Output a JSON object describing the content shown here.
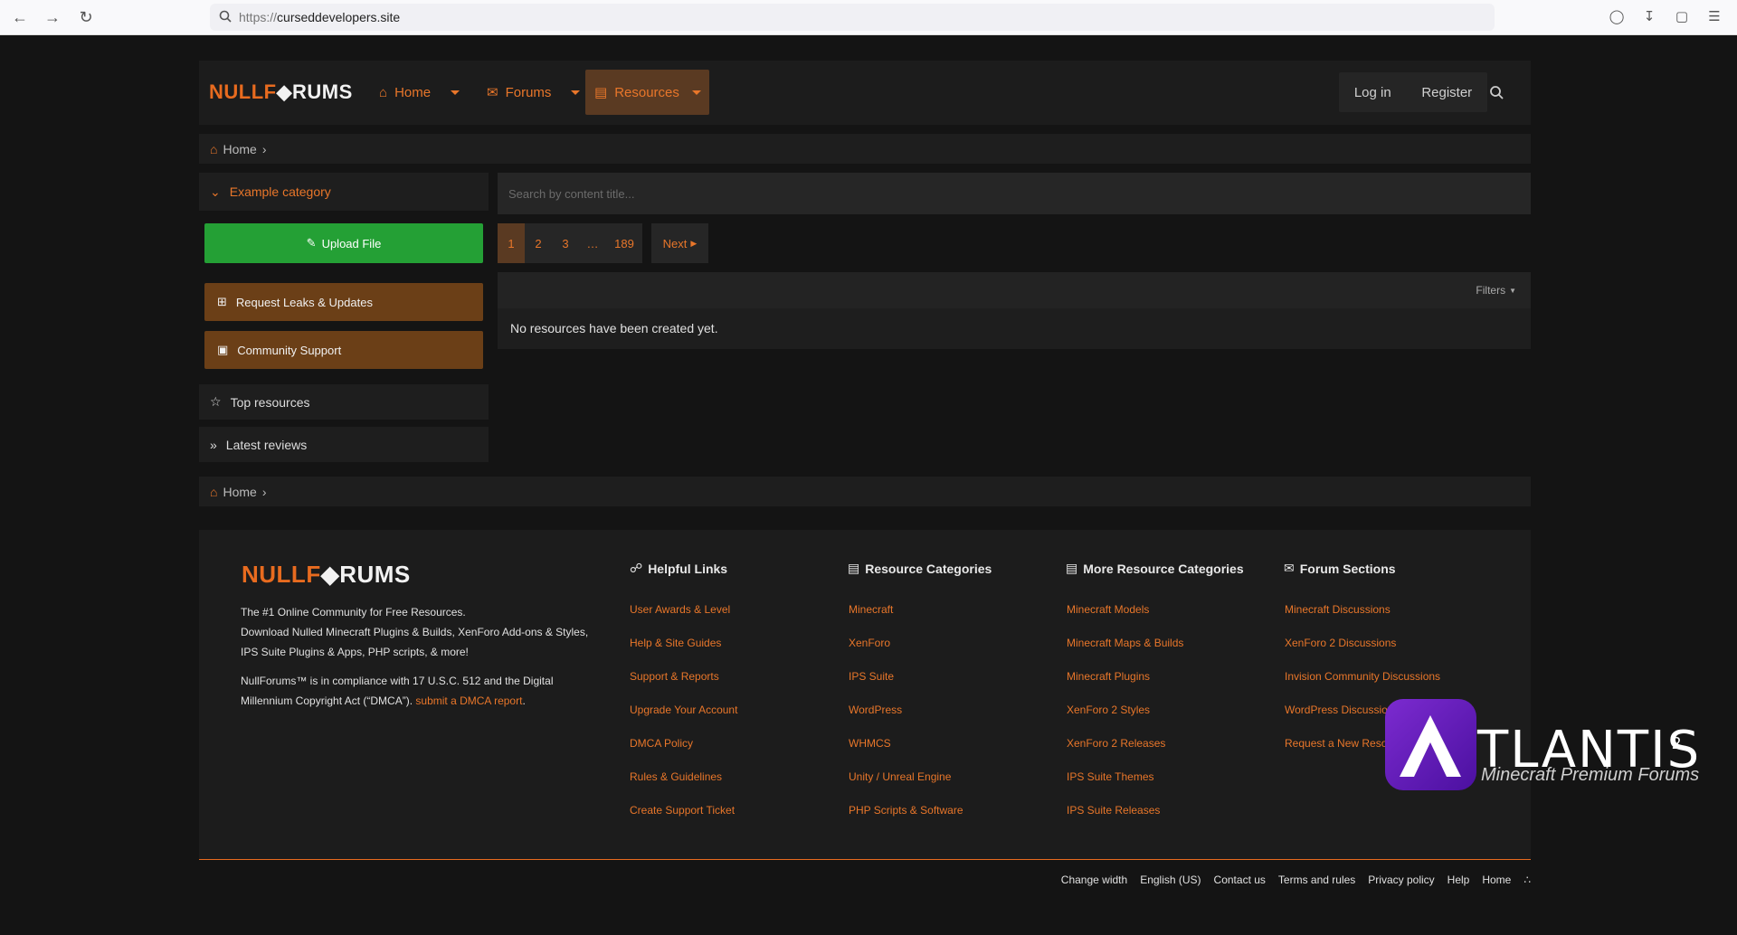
{
  "browser": {
    "url_scheme": "https://",
    "url_host": "curseddevelopers.site"
  },
  "header": {
    "logo_null": "NULLF",
    "logo_rest": "RUMS",
    "nav": {
      "home": "Home",
      "forums": "Forums",
      "resources": "Resources"
    },
    "login": "Log in",
    "register": "Register"
  },
  "breadcrumb": {
    "home": "Home",
    "separator": "›"
  },
  "sidebar": {
    "category": "Example category",
    "upload": "Upload File",
    "request": "Request Leaks & Updates",
    "support": "Community Support",
    "top_resources": "Top resources",
    "latest_reviews": "Latest reviews"
  },
  "main": {
    "search_placeholder": "Search by content title...",
    "pages": [
      "1",
      "2",
      "3",
      "…",
      "189"
    ],
    "next": "Next",
    "filters": "Filters",
    "empty": "No resources have been created yet."
  },
  "footer": {
    "desc1": "The #1 Online Community for Free Resources.",
    "desc2": "Download Nulled Minecraft Plugins & Builds, XenForo Add-ons & Styles,",
    "desc3": "IPS Suite Plugins & Apps, PHP scripts, & more!",
    "legal1": "NullForums™ is in compliance with 17 U.S.C. 512 and the Digital",
    "legal2": "Millennium Copyright Act (“DMCA”).",
    "dmca_link": "submit a DMCA report",
    "columns": {
      "helpful": {
        "title": "Helpful Links",
        "links": [
          "User Awards & Level",
          "Help & Site Guides",
          "Support & Reports",
          "Upgrade Your Account",
          "DMCA Policy",
          "Rules & Guidelines",
          "Create Support Ticket"
        ]
      },
      "categories": {
        "title": "Resource Categories",
        "links": [
          "Minecraft",
          "XenForo",
          "IPS Suite",
          "WordPress",
          "WHMCS",
          "Unity / Unreal Engine",
          "PHP Scripts & Software"
        ]
      },
      "more": {
        "title": "More Resource Categories",
        "links": [
          "Minecraft Models",
          "Minecraft Maps & Builds",
          "Minecraft Plugins",
          "XenForo 2 Styles",
          "XenForo 2 Releases",
          "IPS Suite Themes",
          "IPS Suite Releases"
        ]
      },
      "forums": {
        "title": "Forum Sections",
        "links": [
          "Minecraft Discussions",
          "XenForo 2 Discussions",
          "Invision Community Discussions",
          "WordPress Discussions",
          "Request a New Resource"
        ]
      }
    },
    "bottom": [
      "Change width",
      "English (US)",
      "Contact us",
      "Terms and rules",
      "Privacy policy",
      "Help",
      "Home"
    ]
  },
  "overlay": {
    "brand": "TLANTIS",
    "sup": "2",
    "sub": "Minecraft Premium Forums"
  },
  "colors": {
    "accent": "#e8762a",
    "green": "#24a035",
    "brown": "#6b3f17"
  }
}
